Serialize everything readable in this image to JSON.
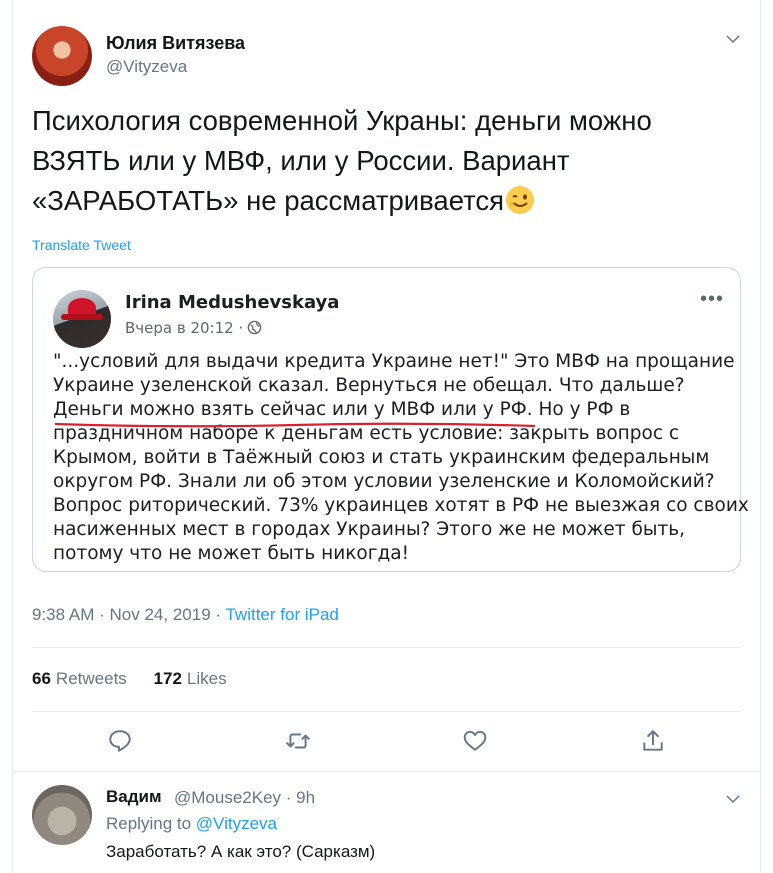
{
  "tweet": {
    "author_name": "Юлия Витязева",
    "author_handle": "@Vityzeva",
    "text": "Психология современной Украны: деньги можно ВЗЯТЬ или у МВФ, или у России. Вариант «ЗАРАБОТАТЬ» не рассматривается",
    "text_lines": [
      "Психология современной Украны: деньги можно",
      "ВЗЯТЬ или у МВФ, или у России. Вариант",
      "«ЗАРАБОТАТЬ» не рассматривается"
    ],
    "emoji_icon": "winking-face-emoji",
    "translate_label": "Translate Tweet",
    "time": "9:38 AM",
    "date": "Nov 24, 2019",
    "separator": "·",
    "source": "Twitter for iPad",
    "retweets_count": "66",
    "retweets_label": "Retweets",
    "likes_count": "172",
    "likes_label": "Likes"
  },
  "quote": {
    "author_name": "Irina Medushevskaya",
    "meta": "Вчера в 20:12 ·",
    "more": "•••",
    "body_lines": [
      "\"...условий для выдачи кредита Украине нет!\" Это МВФ на прощание",
      "Украине узеленской сказал. Вернуться не обещал. Что дальше?",
      "Деньги можно взять сейчас или у МВФ или у РФ. Но у РФ в",
      "праздничном наборе к деньгам есть условие: закрыть вопрос с",
      "Крымом, войти в Таёжный союз и стать украинским федеральным",
      "округом РФ. Знали ли об этом условии узеленские и Коломойский?",
      "Вопрос риторический. 73% украинцев хотят в РФ не выезжая со своих",
      "насиженных мест в городах Украины? Этого же не может быть,",
      "потому что не может быть никогда!"
    ],
    "underline_color": "#d9202e"
  },
  "actions": [
    "reply-icon",
    "retweet-icon",
    "like-icon",
    "share-icon"
  ],
  "reply": {
    "author_name": "Вадим",
    "author_handle": "@Mouse2Key · 9h",
    "replying_label": "Replying to",
    "replying_mention": "@Vityzeva",
    "text": "Заработать? А как это? (Сарказм)"
  },
  "colors": {
    "link": "#1da1f2",
    "muted": "#657786",
    "border": "#e6ecf0"
  }
}
